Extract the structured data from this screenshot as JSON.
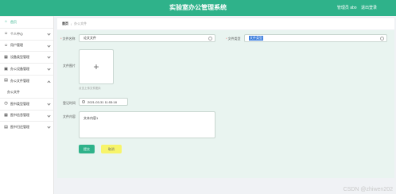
{
  "header": {
    "title": "实验室办公管理系统",
    "user_label": "管理员 abo",
    "logout_label": "退出登录"
  },
  "sidebar": {
    "items": [
      {
        "label": "首页",
        "icon": "home-icon"
      },
      {
        "label": "个人中心",
        "icon": "user-icon"
      },
      {
        "label": "用户管理",
        "icon": "users-icon"
      },
      {
        "label": "设备类型管理",
        "icon": "grid-icon"
      },
      {
        "label": "办公设备管理",
        "icon": "device-icon"
      },
      {
        "label": "办公文件管理",
        "icon": "file-icon"
      },
      {
        "label": "办公文件",
        "icon": ""
      },
      {
        "label": "图书类型管理",
        "icon": "clock-icon"
      },
      {
        "label": "图书信息管理",
        "icon": "grid-icon"
      },
      {
        "label": "图书归还管理",
        "icon": "doc-icon"
      }
    ]
  },
  "breadcrumb": {
    "home": "首页",
    "separator": "/",
    "current": "办公文件"
  },
  "form": {
    "file_name_label": "文件名称",
    "file_name_value": "论文文件",
    "file_type_label": "文件类型",
    "file_type_value": "文件类型",
    "file_image_label": "文件图片",
    "upload_hint": "点击上传文件图片",
    "date_label": "登记时间",
    "date_value": "2021-03-31 11:53:18",
    "content_label": "文件内容",
    "content_value": "文本内容1",
    "submit_label": "提交",
    "cancel_label": "取消"
  },
  "watermark": "CSDN @zhiwen202"
}
